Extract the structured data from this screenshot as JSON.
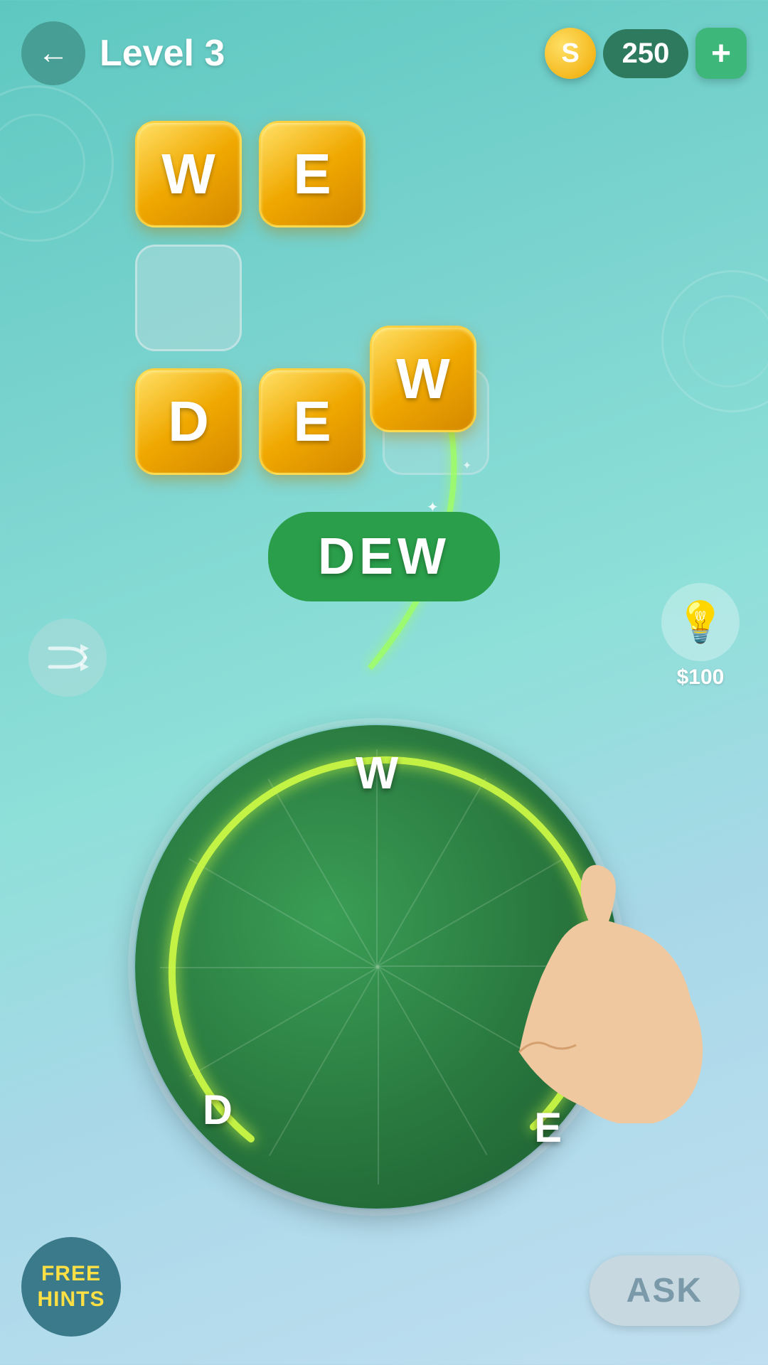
{
  "header": {
    "back_label": "←",
    "level_label": "Level 3",
    "coin_icon": "S",
    "coin_count": "250",
    "add_label": "+"
  },
  "tiles": {
    "row1": [
      {
        "letter": "W",
        "state": "gold"
      },
      {
        "letter": "E",
        "state": "gold"
      }
    ],
    "row2": [
      {
        "letter": "",
        "state": "empty"
      }
    ],
    "row3": [
      {
        "letter": "D",
        "state": "gold"
      },
      {
        "letter": "E",
        "state": "gold"
      },
      {
        "letter": "W",
        "state": "gold_slot"
      }
    ]
  },
  "word_display": {
    "word": "DEW"
  },
  "shuffle_btn": {
    "icon": "⇄"
  },
  "hint_btn": {
    "icon": "💡",
    "price": "$100"
  },
  "wheel": {
    "letters": [
      {
        "char": "W",
        "angle": 270
      },
      {
        "char": "D",
        "angle": 195
      },
      {
        "char": "E",
        "angle": 340
      }
    ]
  },
  "free_hints": {
    "line1": "FREE",
    "line2": "HINTS"
  },
  "ask_btn": {
    "label": "ASK"
  }
}
